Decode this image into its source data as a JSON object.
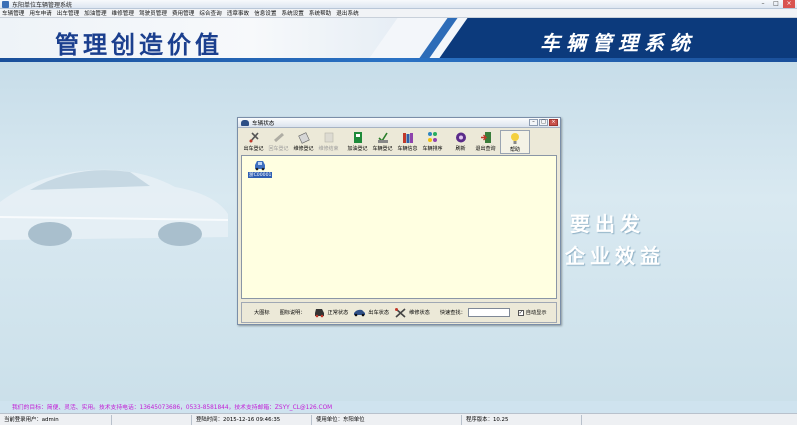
{
  "window": {
    "title": "东阳单位车辆管理系统"
  },
  "menu": [
    "车辆管理",
    "用车申请",
    "出车管理",
    "加油管理",
    "维修管理",
    "驾驶员管理",
    "费用管理",
    "综合查询",
    "违章事故",
    "信息设置",
    "系统设置",
    "系统帮助",
    "退出系统"
  ],
  "banner": {
    "slogan": "管理创造价值",
    "system_name": "车辆管理系统"
  },
  "background_text": {
    "line1": "要出发",
    "line2": "企业效益"
  },
  "dialog": {
    "title": "车辆状态",
    "toolbar": [
      {
        "label": "出车登记",
        "icon": "car-out-icon",
        "enabled": true
      },
      {
        "label": "回车登记",
        "icon": "car-return-icon",
        "enabled": false
      },
      {
        "label": "维修登记",
        "icon": "repair-register-icon",
        "enabled": true
      },
      {
        "label": "维修结束",
        "icon": "repair-finish-icon",
        "enabled": false
      },
      {
        "label": "加油登记",
        "icon": "fuel-icon",
        "enabled": true
      },
      {
        "label": "车辆登记",
        "icon": "vehicle-register-icon",
        "enabled": true
      },
      {
        "label": "车辆信息",
        "icon": "vehicle-info-icon",
        "enabled": true
      },
      {
        "label": "车辆排序",
        "icon": "sort-icon",
        "enabled": true
      },
      {
        "label": "刷新",
        "icon": "refresh-icon",
        "enabled": true
      },
      {
        "label": "退出查询",
        "icon": "exit-icon",
        "enabled": true
      },
      {
        "label": "帮助",
        "icon": "help-icon",
        "enabled": true
      }
    ],
    "vehicle": {
      "plate": "浙C00001",
      "icon": "car-parked-icon"
    },
    "legend": {
      "big_icon": "大图标",
      "icon_legend": "图标说明：",
      "normal": "正常状态",
      "out": "出车状态",
      "repair": "维修状态",
      "quick_search": "快速查找：",
      "auto_show": "自动显示",
      "auto_show_checked": true
    }
  },
  "contact_line": "我们的目标：简便、灵活、实用。技术支持电话：13645073686，0533-8581844，技术支持邮箱：ZSYY_CL@126.COM",
  "status": {
    "user_label": "当前登录用户：",
    "user": "admin",
    "time_label": "登陆时间：",
    "time": "2015-12-16 09:46:35",
    "unit_label": "使用单位：",
    "unit": "东阳单位",
    "version_label": "程序版本：",
    "version": "10.25"
  },
  "colors": {
    "banner_blue": "#0c3a7c",
    "dialog_canvas": "#ffffe1",
    "contact_text": "#c21ad6"
  }
}
